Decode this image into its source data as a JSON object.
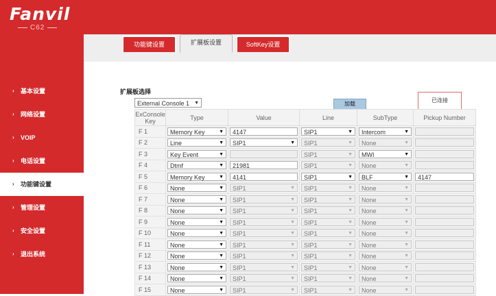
{
  "brand": {
    "logo": "Fanvil",
    "model": "C62"
  },
  "tabs": [
    {
      "label": "功能键设置",
      "active": false
    },
    {
      "label": "扩展板设置",
      "active": true
    },
    {
      "label": "SoftKey设置",
      "active": false
    }
  ],
  "nav": [
    {
      "label": "基本设置",
      "active": false
    },
    {
      "label": "网络设置",
      "active": false
    },
    {
      "label": "VOIP",
      "active": false
    },
    {
      "label": "电话设置",
      "active": false
    },
    {
      "label": "功能键设置",
      "active": true
    },
    {
      "label": "管理设置",
      "active": false
    },
    {
      "label": "安全设置",
      "active": false
    },
    {
      "label": "退出系统",
      "active": false
    }
  ],
  "section": {
    "title": "扩展板选择",
    "console_select": "External Console 1",
    "load_button": "加载",
    "status": "已连接"
  },
  "table": {
    "headers": [
      "ExConsole Key",
      "Type",
      "Value",
      "Line",
      "SubType",
      "Pickup Number"
    ],
    "rows": [
      {
        "key": "F 1",
        "type": "Memory Key",
        "type_dis": false,
        "value": "4147",
        "value_kind": "input",
        "value_dis": false,
        "line": "SIP1",
        "line_dis": false,
        "subtype": "Intercom",
        "subtype_dis": false,
        "pickup": "",
        "pickup_dis": true
      },
      {
        "key": "F 2",
        "type": "Line",
        "type_dis": false,
        "value": "SIP1",
        "value_kind": "select",
        "value_dis": false,
        "line": "SIP1",
        "line_dis": true,
        "subtype": "None",
        "subtype_dis": true,
        "pickup": "",
        "pickup_dis": true
      },
      {
        "key": "F 3",
        "type": "Key Event",
        "type_dis": false,
        "value": "",
        "value_kind": "input",
        "value_dis": true,
        "line": "SIP1",
        "line_dis": true,
        "subtype": "MWI",
        "subtype_dis": false,
        "pickup": "",
        "pickup_dis": true
      },
      {
        "key": "F 4",
        "type": "Dtmf",
        "type_dis": false,
        "value": "21981",
        "value_kind": "input",
        "value_dis": false,
        "line": "SIP1",
        "line_dis": true,
        "subtype": "None",
        "subtype_dis": true,
        "pickup": "",
        "pickup_dis": true
      },
      {
        "key": "F 5",
        "type": "Memory Key",
        "type_dis": false,
        "value": "4141",
        "value_kind": "input",
        "value_dis": false,
        "line": "SIP1",
        "line_dis": false,
        "subtype": "BLF",
        "subtype_dis": false,
        "pickup": "4147",
        "pickup_dis": false
      },
      {
        "key": "F 6",
        "type": "None",
        "type_dis": false,
        "value": "SIP1",
        "value_kind": "select",
        "value_dis": true,
        "line": "SIP1",
        "line_dis": true,
        "subtype": "None",
        "subtype_dis": true,
        "pickup": "",
        "pickup_dis": true
      },
      {
        "key": "F 7",
        "type": "None",
        "type_dis": false,
        "value": "SIP1",
        "value_kind": "select",
        "value_dis": true,
        "line": "SIP1",
        "line_dis": true,
        "subtype": "None",
        "subtype_dis": true,
        "pickup": "",
        "pickup_dis": true
      },
      {
        "key": "F 8",
        "type": "None",
        "type_dis": false,
        "value": "SIP1",
        "value_kind": "select",
        "value_dis": true,
        "line": "SIP1",
        "line_dis": true,
        "subtype": "None",
        "subtype_dis": true,
        "pickup": "",
        "pickup_dis": true
      },
      {
        "key": "F 9",
        "type": "None",
        "type_dis": false,
        "value": "SIP1",
        "value_kind": "select",
        "value_dis": true,
        "line": "SIP1",
        "line_dis": true,
        "subtype": "None",
        "subtype_dis": true,
        "pickup": "",
        "pickup_dis": true
      },
      {
        "key": "F 10",
        "type": "None",
        "type_dis": false,
        "value": "SIP1",
        "value_kind": "select",
        "value_dis": true,
        "line": "SIP1",
        "line_dis": true,
        "subtype": "None",
        "subtype_dis": true,
        "pickup": "",
        "pickup_dis": true
      },
      {
        "key": "F 11",
        "type": "None",
        "type_dis": false,
        "value": "SIP1",
        "value_kind": "select",
        "value_dis": true,
        "line": "SIP1",
        "line_dis": true,
        "subtype": "None",
        "subtype_dis": true,
        "pickup": "",
        "pickup_dis": true
      },
      {
        "key": "F 12",
        "type": "None",
        "type_dis": false,
        "value": "SIP1",
        "value_kind": "select",
        "value_dis": true,
        "line": "SIP1",
        "line_dis": true,
        "subtype": "None",
        "subtype_dis": true,
        "pickup": "",
        "pickup_dis": true
      },
      {
        "key": "F 13",
        "type": "None",
        "type_dis": false,
        "value": "SIP1",
        "value_kind": "select",
        "value_dis": true,
        "line": "SIP1",
        "line_dis": true,
        "subtype": "None",
        "subtype_dis": true,
        "pickup": "",
        "pickup_dis": true
      },
      {
        "key": "F 14",
        "type": "None",
        "type_dis": false,
        "value": "SIP1",
        "value_kind": "select",
        "value_dis": true,
        "line": "SIP1",
        "line_dis": true,
        "subtype": "None",
        "subtype_dis": true,
        "pickup": "",
        "pickup_dis": true
      },
      {
        "key": "F 15",
        "type": "None",
        "type_dis": false,
        "value": "SIP1",
        "value_kind": "select",
        "value_dis": true,
        "line": "SIP1",
        "line_dis": true,
        "subtype": "None",
        "subtype_dis": true,
        "pickup": "",
        "pickup_dis": true
      }
    ]
  },
  "colors": {
    "brand_red": "#d42a2c",
    "button_blue": "#aac8e0",
    "status_border": "#d96a6a"
  }
}
